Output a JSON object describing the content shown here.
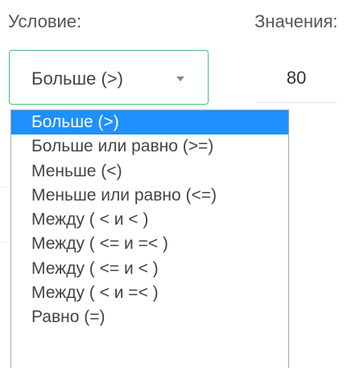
{
  "labels": {
    "condition": "Условие:",
    "values": "Значения:"
  },
  "condition_select": {
    "selected": "Больше (>)",
    "arrow_icon": "caret-down-icon",
    "accent_color": "#3fc07d"
  },
  "value_input": {
    "value": "80"
  },
  "dropdown": {
    "highlight_color": "#1e90ff",
    "options": [
      {
        "label": "Больше (>)",
        "selected": true
      },
      {
        "label": "Больше или равно (>=)",
        "selected": false
      },
      {
        "label": "Меньше (<)",
        "selected": false
      },
      {
        "label": "Меньше или равно (<=)",
        "selected": false
      },
      {
        "label": "Между ( < и < )",
        "selected": false
      },
      {
        "label": "Между ( <= и =< )",
        "selected": false
      },
      {
        "label": "Между ( <= и < )",
        "selected": false
      },
      {
        "label": "Между ( < и =< )",
        "selected": false
      },
      {
        "label": "Равно (=)",
        "selected": false
      }
    ]
  }
}
